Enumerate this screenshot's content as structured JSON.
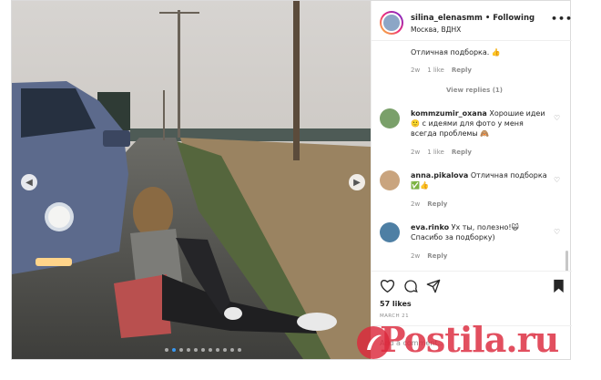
{
  "post": {
    "username": "silina_elenasmm",
    "follow_state": "• Following",
    "location": "Москва, ВДНХ",
    "more_label": "•••",
    "likes": "57 likes",
    "date": "MARCH 21",
    "add_comment_placeholder": "Add a comment..."
  },
  "carousel": {
    "dot_count": 11,
    "active_index": 1,
    "prev_icon": "chevron-left-icon",
    "next_icon": "chevron-right-icon"
  },
  "comments": {
    "first_tail": "Отличная подборка. 👍",
    "first_meta": {
      "time": "2w",
      "likes": "1 like",
      "reply": "Reply"
    },
    "view_replies": "View replies (1)",
    "items": [
      {
        "user": "kommzumir_oxana",
        "text": "Хорошие идеи 🙂 с идеями для фото у меня всегда проблемы 🙈",
        "time": "2w",
        "likes": "1 like",
        "reply": "Reply"
      },
      {
        "user": "anna.pikalova",
        "text": "Отличная подборка ✅👍",
        "time": "2w",
        "reply": "Reply"
      },
      {
        "user": "eva.rinko",
        "text": "Ух ты, полезно!🙀 Спасибо за подборку)",
        "time": "2w",
        "reply": "Reply"
      }
    ]
  },
  "watermark": {
    "text": "Postila.ru",
    "color": "#dc283c"
  },
  "colors": {
    "accent": "#3897f0",
    "text": "#262626",
    "muted": "#8e8e8e"
  }
}
